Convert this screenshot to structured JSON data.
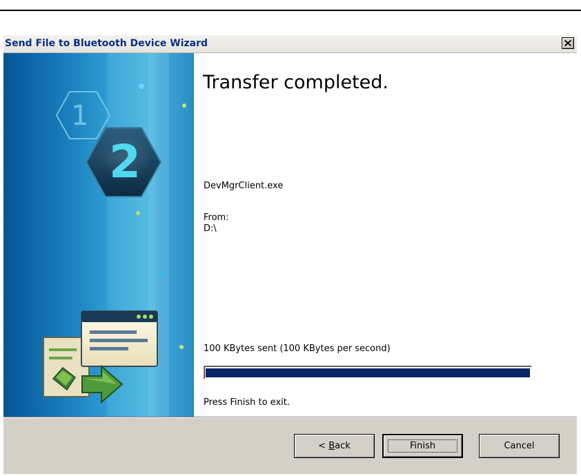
{
  "window": {
    "title": "Send File to Bluetooth Device Wizard",
    "close_label": "×"
  },
  "sidebar": {
    "step_previous": "1",
    "step_current": "2"
  },
  "content": {
    "heading": "Transfer completed.",
    "filename": "DevMgrClient.exe",
    "from_label": "From:",
    "from_path": "D:\\",
    "status": "100 KBytes sent (100 KBytes per second)",
    "progress": 1.0,
    "hint": "Press Finish to exit."
  },
  "buttons": {
    "back_prefix": "< ",
    "back_mnemonic": "B",
    "back_rest": "ack",
    "finish": "Finish",
    "cancel": "Cancel"
  },
  "colors": {
    "progress_fill": "#0c2468",
    "title_text": "#0a2f86"
  }
}
